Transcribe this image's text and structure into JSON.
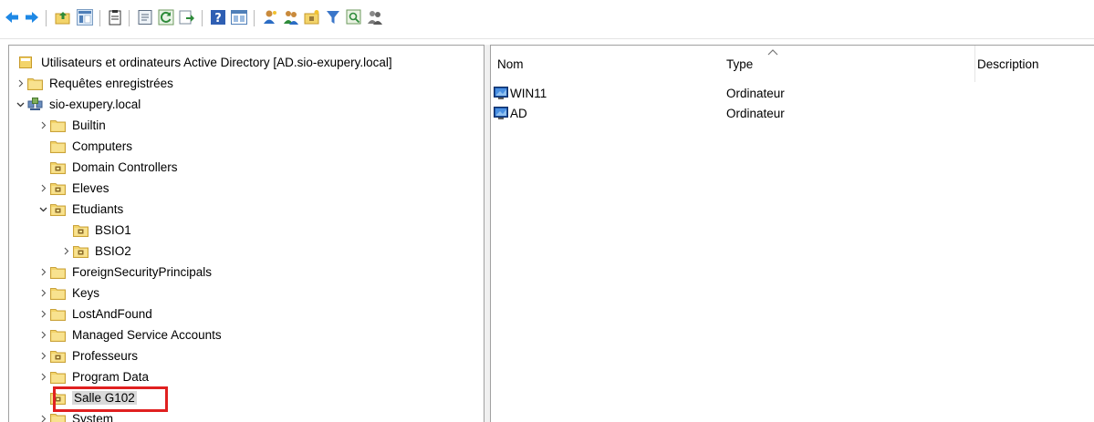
{
  "toolbar": {
    "buttons": [
      {
        "name": "back-icon",
        "color": "#1e88e5"
      },
      {
        "name": "forward-icon",
        "color": "#1e88e5"
      },
      {
        "name": "up-folder-icon"
      },
      {
        "name": "show-console-tree-icon"
      },
      {
        "name": "clipboard-icon"
      },
      {
        "name": "properties-icon"
      },
      {
        "name": "refresh-icon"
      },
      {
        "name": "export-list-icon"
      },
      {
        "name": "help-icon"
      },
      {
        "name": "view-icon"
      },
      {
        "name": "new-user-icon"
      },
      {
        "name": "new-group-icon"
      },
      {
        "name": "new-ou-icon"
      },
      {
        "name": "filter-icon"
      },
      {
        "name": "find-icon"
      },
      {
        "name": "add-to-group-icon"
      }
    ]
  },
  "tree": {
    "root_label": "Utilisateurs et ordinateurs Active Directory [AD.sio-exupery.local]",
    "items": [
      {
        "label": "Requêtes enregistrées",
        "expander": "collapsed",
        "icon": "folder"
      },
      {
        "label": "sio-exupery.local",
        "expander": "expanded",
        "icon": "domain"
      },
      {
        "label": "Builtin",
        "expander": "collapsed",
        "icon": "folder"
      },
      {
        "label": "Computers",
        "expander": "none",
        "icon": "folder"
      },
      {
        "label": "Domain Controllers",
        "expander": "none",
        "icon": "ou"
      },
      {
        "label": "Eleves",
        "expander": "collapsed",
        "icon": "ou"
      },
      {
        "label": "Etudiants",
        "expander": "expanded",
        "icon": "ou"
      },
      {
        "label": "BSIO1",
        "expander": "none",
        "icon": "ou"
      },
      {
        "label": "BSIO2",
        "expander": "collapsed",
        "icon": "ou"
      },
      {
        "label": "ForeignSecurityPrincipals",
        "expander": "collapsed",
        "icon": "folder"
      },
      {
        "label": "Keys",
        "expander": "collapsed",
        "icon": "folder"
      },
      {
        "label": "LostAndFound",
        "expander": "collapsed",
        "icon": "folder"
      },
      {
        "label": "Managed Service Accounts",
        "expander": "collapsed",
        "icon": "folder"
      },
      {
        "label": "Professeurs",
        "expander": "collapsed",
        "icon": "ou"
      },
      {
        "label": "Program Data",
        "expander": "collapsed",
        "icon": "folder"
      },
      {
        "label": "Salle G102",
        "expander": "none",
        "icon": "ou",
        "selected": true
      },
      {
        "label": "System",
        "expander": "collapsed",
        "icon": "folder"
      }
    ]
  },
  "list": {
    "columns": [
      "Nom",
      "Type",
      "Description"
    ],
    "rows": [
      {
        "name": "WIN11",
        "type": "Ordinateur",
        "description": ""
      },
      {
        "name": "AD",
        "type": "Ordinateur",
        "description": ""
      }
    ]
  },
  "colors": {
    "highlight_border": "#e02020",
    "folder": "#f3d46a",
    "folder_dark": "#d9a92f",
    "back_arrow": "#1e88e5"
  }
}
